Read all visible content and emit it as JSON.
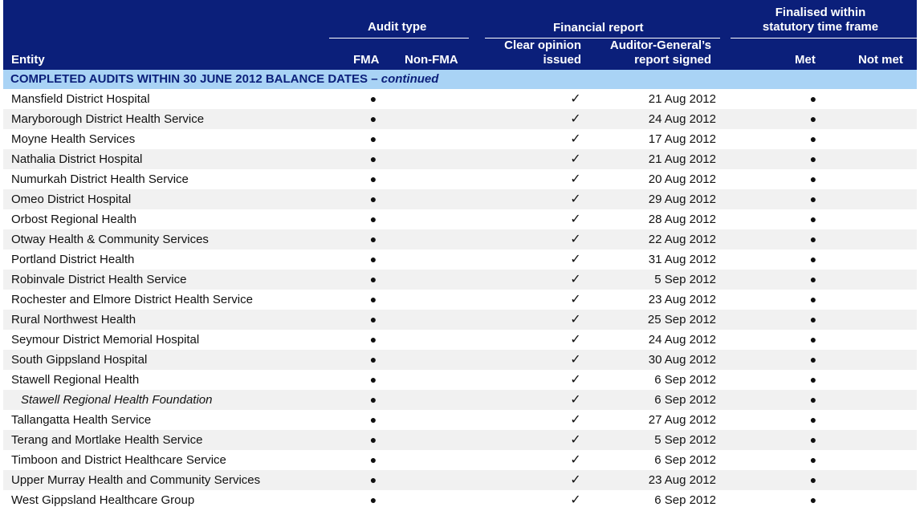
{
  "header": {
    "entity": "Entity",
    "audit_type": "Audit type",
    "fma": "FMA",
    "non_fma": "Non-FMA",
    "financial_report": "Financial report",
    "clear_opinion_1": "Clear opinion",
    "clear_opinion_2": "issued",
    "ag_signed_1": "Auditor-General’s",
    "ag_signed_2": "report signed",
    "finalised_1": "Finalised within",
    "finalised_2": "statutory time frame",
    "met": "Met",
    "not_met": "Not met"
  },
  "section": {
    "title": "COMPLETED AUDITS WITHIN 30 JUNE 2012 BALANCE DATES – ",
    "suffix": "continued"
  },
  "marks": {
    "bullet": "●",
    "tick": "✓"
  },
  "rows": [
    {
      "entity": "Mansfield District Hospital",
      "date": "21 Aug 2012",
      "sub": false
    },
    {
      "entity": "Maryborough District Health Service",
      "date": "24 Aug 2012",
      "sub": false
    },
    {
      "entity": "Moyne Health Services",
      "date": "17 Aug 2012",
      "sub": false
    },
    {
      "entity": "Nathalia District Hospital",
      "date": "21 Aug 2012",
      "sub": false
    },
    {
      "entity": "Numurkah District Health Service",
      "date": "20 Aug 2012",
      "sub": false
    },
    {
      "entity": "Omeo District Hospital",
      "date": "29 Aug 2012",
      "sub": false
    },
    {
      "entity": "Orbost Regional Health",
      "date": "28 Aug 2012",
      "sub": false
    },
    {
      "entity": "Otway Health & Community  Services",
      "date": "22 Aug 2012",
      "sub": false
    },
    {
      "entity": "Portland District Health",
      "date": "31 Aug 2012",
      "sub": false
    },
    {
      "entity": "Robinvale District Health Service",
      "date": "5 Sep 2012",
      "sub": false
    },
    {
      "entity": "Rochester and Elmore District Health Service",
      "date": "23 Aug 2012",
      "sub": false
    },
    {
      "entity": "Rural Northwest Health",
      "date": "25 Sep 2012",
      "sub": false
    },
    {
      "entity": "Seymour District Memorial Hospital",
      "date": "24 Aug 2012",
      "sub": false
    },
    {
      "entity": "South Gippsland Hospital",
      "date": "30 Aug 2012",
      "sub": false
    },
    {
      "entity": "Stawell Regional Health",
      "date": "6 Sep 2012",
      "sub": false
    },
    {
      "entity": "Stawell Regional Health Foundation",
      "date": "6 Sep 2012",
      "sub": true
    },
    {
      "entity": "Tallangatta Health Service",
      "date": "27 Aug 2012",
      "sub": false
    },
    {
      "entity": "Terang and Mortlake Health Service",
      "date": "5 Sep 2012",
      "sub": false
    },
    {
      "entity": "Timboon and District Healthcare Service",
      "date": "6 Sep 2012",
      "sub": false
    },
    {
      "entity": "Upper Murray Health and Community Services",
      "date": "23 Aug 2012",
      "sub": false
    },
    {
      "entity": "West Gippsland Healthcare Group",
      "date": "6 Sep 2012",
      "sub": false
    }
  ]
}
